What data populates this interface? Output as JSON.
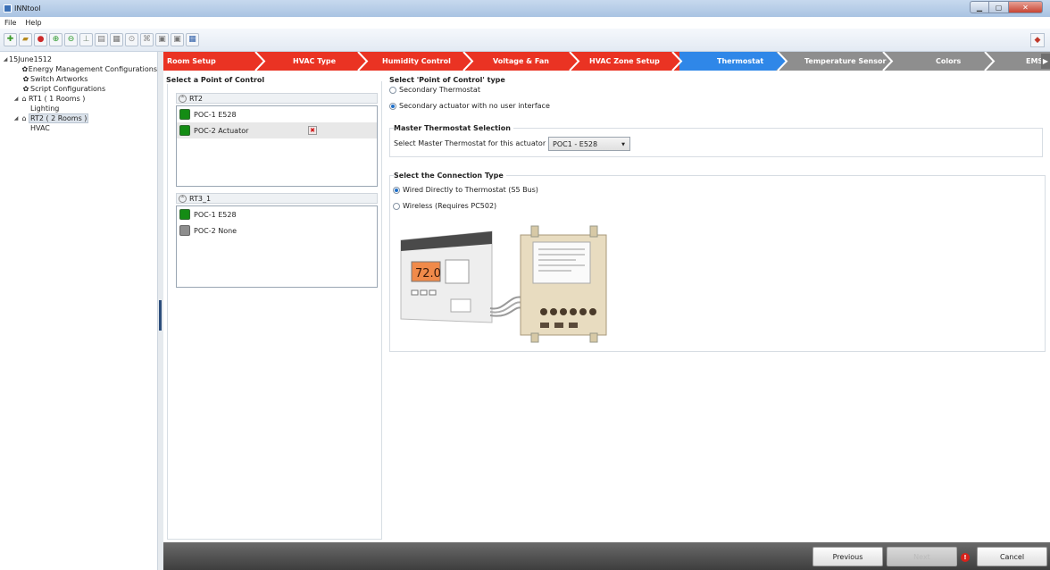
{
  "window": {
    "title": "INNtool"
  },
  "menu": [
    "File",
    "Help"
  ],
  "toolbar": {
    "buttons": [
      "new-icon",
      "open-icon",
      "save-alert-icon",
      "add-icon",
      "remove-icon",
      "pin-icon",
      "document-icon",
      "export-icon",
      "download-icon",
      "tree-icon",
      "copy-icon",
      "paste-icon",
      "save-disk-icon"
    ],
    "right_button": "eraser-icon"
  },
  "tree": {
    "root": "15June1512",
    "items": [
      {
        "label": "Energy Management Configurations",
        "icon": "gear-icon"
      },
      {
        "label": "Switch Artworks",
        "icon": "gear-icon"
      },
      {
        "label": "Script Configurations",
        "icon": "gear-icon"
      },
      {
        "label": "RT1 ( 1 Rooms )",
        "icon": "building-icon"
      },
      {
        "label": "Lighting"
      },
      {
        "label": "RT2 ( 2 Rooms )",
        "icon": "building-icon"
      },
      {
        "label": "HVAC"
      }
    ]
  },
  "steps": [
    "Room Setup",
    "HVAC Type",
    "Humidity Control",
    "Voltage & Fan",
    "HVAC Zone Setup",
    "Thermostat",
    "Temperature Sensor",
    "Colors",
    "EMS"
  ],
  "colors": {
    "step_done": "#ea3323",
    "step_current": "#2f87e8",
    "step_todo": "#8e8e8e"
  },
  "poc_panel": {
    "title": "Select a Point of Control",
    "groups": [
      {
        "name": "RT2",
        "items": [
          {
            "label": "POC-1  E528",
            "status": "green"
          },
          {
            "label": "POC-2  Actuator",
            "status": "green"
          }
        ]
      },
      {
        "name": "RT3_1",
        "items": [
          {
            "label": "POC-1  E528",
            "status": "green"
          },
          {
            "label": "POC-2  None",
            "status": "gray"
          }
        ]
      }
    ]
  },
  "poc_type": {
    "title": "Select 'Point of Control' type",
    "options": [
      "Secondary Thermostat",
      "Secondary actuator with no user interface"
    ],
    "selected_index": 1
  },
  "master": {
    "title": "Master Thermostat Selection",
    "label": "Select Master Thermostat for this actuator",
    "value": "POC1 - E528"
  },
  "connection": {
    "title": "Select the Connection Type",
    "options": [
      "Wired Directly to Thermostat (S5 Bus)",
      "Wireless (Requires PC502)"
    ],
    "selected_index": 0
  },
  "illustration": {
    "display": "72.0"
  },
  "footer": {
    "previous": "Previous",
    "next": "Next",
    "cancel": "Cancel",
    "warning": "!"
  }
}
